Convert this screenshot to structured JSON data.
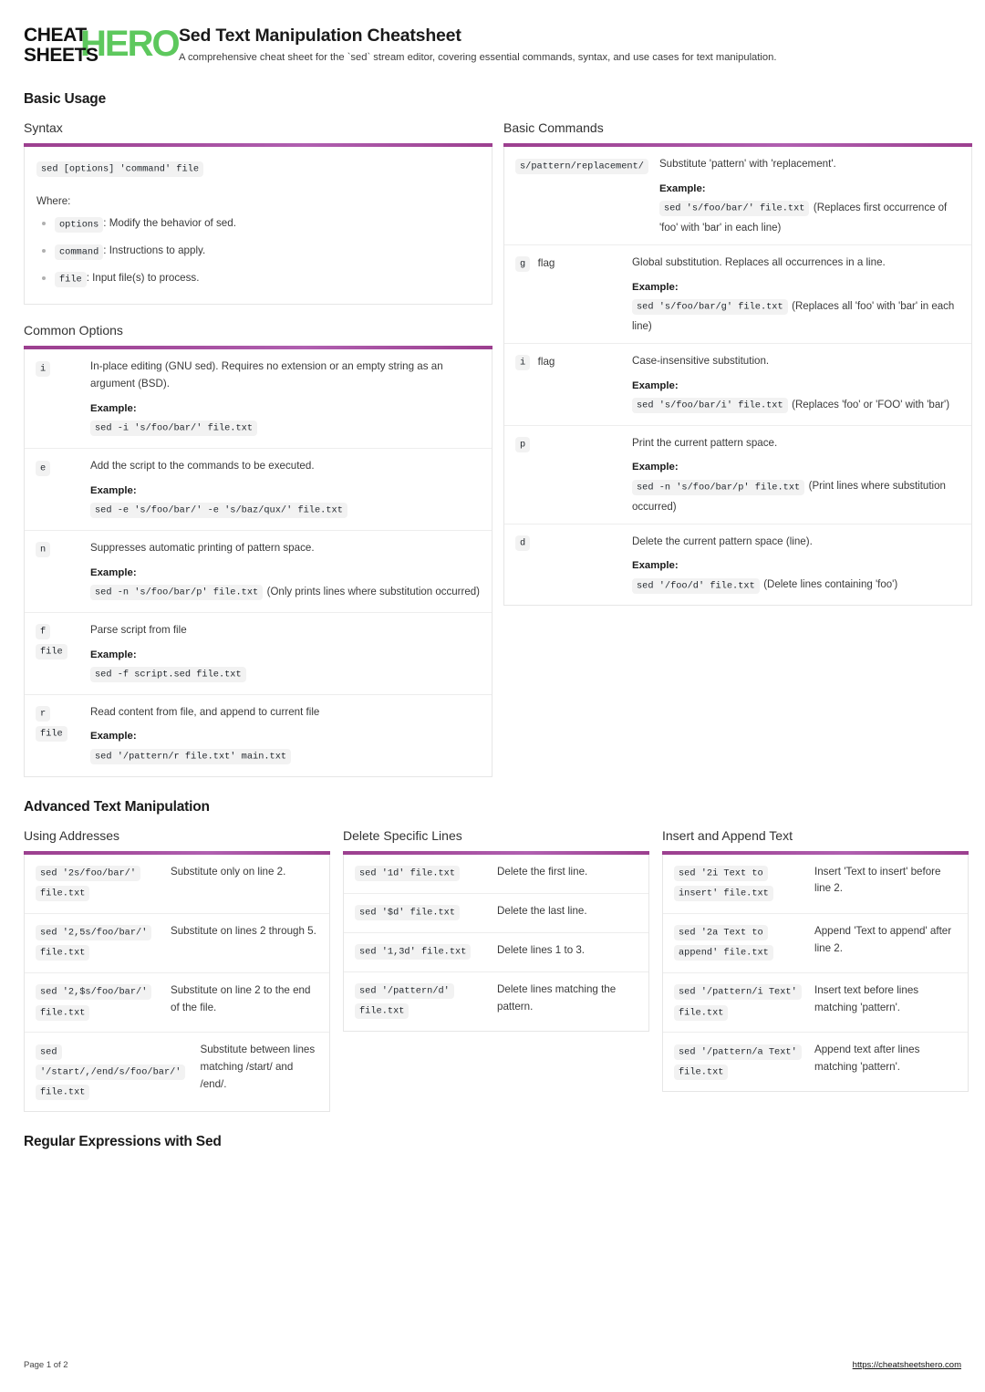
{
  "brand": {
    "line1": "CHEAT",
    "line2": "SHEETS",
    "hero": "HERO",
    "hero_color": "#5dc85d"
  },
  "header": {
    "title": "Sed Text Manipulation Cheatsheet",
    "subtitle": "A comprehensive cheat sheet for the `sed` stream editor, covering essential commands, syntax, and use cases for text manipulation."
  },
  "accent_color": "#9c3f8f",
  "sections": {
    "basic_usage": "Basic Usage",
    "advanced": "Advanced Text Manipulation",
    "regex": "Regular Expressions with Sed"
  },
  "syntax": {
    "heading": "Syntax",
    "code": "sed [options] 'command' file",
    "where": "Where:",
    "bullets": [
      {
        "code": "options",
        "text": ": Modify the behavior of sed."
      },
      {
        "code": "command",
        "text": ": Instructions to apply."
      },
      {
        "code": "file",
        "text": ": Input file(s) to process."
      }
    ]
  },
  "common_options": {
    "heading": "Common Options",
    "example_label": "Example:",
    "rows": [
      {
        "opt": "i",
        "opt2": "",
        "desc": "In-place editing (GNU sed). Requires no extension or an empty string as an argument (BSD).",
        "example": "sed -i 's/foo/bar/' file.txt",
        "note": ""
      },
      {
        "opt": "e",
        "opt2": "",
        "desc": "Add the script to the commands to be executed.",
        "example": "sed -e 's/foo/bar/' -e 's/baz/qux/' file.txt",
        "note": ""
      },
      {
        "opt": "n",
        "opt2": "",
        "desc": "Suppresses automatic printing of pattern space.",
        "example": "sed -n 's/foo/bar/p' file.txt",
        "note": "(Only prints lines where substitution occurred)"
      },
      {
        "opt": "f",
        "opt2": "file",
        "desc": "Parse script from file",
        "example": "sed -f script.sed file.txt",
        "note": ""
      },
      {
        "opt": "r",
        "opt2": "file",
        "desc": "Read content from file, and append to current file",
        "example": "sed '/pattern/r file.txt' main.txt",
        "note": ""
      }
    ]
  },
  "basic_commands": {
    "heading": "Basic Commands",
    "example_label": "Example:",
    "rows": [
      {
        "cmd": "s/pattern/replacement/",
        "flag": "",
        "desc": "Substitute 'pattern' with 'replacement'.",
        "example": "sed 's/foo/bar/' file.txt",
        "note": "(Replaces first occurrence of 'foo' with 'bar' in each line)"
      },
      {
        "cmd": "g",
        "flag": "flag",
        "desc": "Global substitution. Replaces all occurrences in a line.",
        "example": "sed 's/foo/bar/g' file.txt",
        "note": "(Replaces all 'foo' with 'bar' in each line)"
      },
      {
        "cmd": "i",
        "flag": "flag",
        "desc": "Case-insensitive substitution.",
        "example": "sed 's/foo/bar/i' file.txt",
        "note": "(Replaces 'foo' or 'FOO' with 'bar')"
      },
      {
        "cmd": "p",
        "flag": "",
        "desc": "Print the current pattern space.",
        "example": "sed -n 's/foo/bar/p' file.txt",
        "note": "(Print lines where substitution occurred)"
      },
      {
        "cmd": "d",
        "flag": "",
        "desc": "Delete the current pattern space (line).",
        "example": "sed '/foo/d' file.txt",
        "note": "(Delete lines containing 'foo')"
      }
    ]
  },
  "using_addresses": {
    "heading": "Using Addresses",
    "rows": [
      {
        "code": "sed '2s/foo/bar/' file.txt",
        "desc": "Substitute only on line 2."
      },
      {
        "code": "sed '2,5s/foo/bar/' file.txt",
        "desc": "Substitute on lines 2 through 5."
      },
      {
        "code": "sed '2,$s/foo/bar/' file.txt",
        "desc": "Substitute on line 2 to the end of the file."
      },
      {
        "code": "sed '/start/,/end/s/foo/bar/' file.txt",
        "desc": "Substitute between lines matching /start/ and /end/."
      }
    ]
  },
  "delete_lines": {
    "heading": "Delete Specific Lines",
    "rows": [
      {
        "code": "sed '1d' file.txt",
        "desc": "Delete the first line."
      },
      {
        "code": "sed '$d' file.txt",
        "desc": "Delete the last line."
      },
      {
        "code": "sed '1,3d' file.txt",
        "desc": "Delete lines 1 to 3."
      },
      {
        "code": "sed '/pattern/d' file.txt",
        "desc": "Delete lines matching the pattern."
      }
    ]
  },
  "insert_append": {
    "heading": "Insert and Append Text",
    "rows": [
      {
        "code": "sed '2i Text to insert' file.txt",
        "desc": "Insert 'Text to insert' before line 2."
      },
      {
        "code": "sed '2a Text to append' file.txt",
        "desc": "Append 'Text to append' after line 2."
      },
      {
        "code": "sed '/pattern/i Text' file.txt",
        "desc": "Insert text before lines matching 'pattern'."
      },
      {
        "code": "sed '/pattern/a Text' file.txt",
        "desc": "Append text after lines matching 'pattern'."
      }
    ]
  },
  "footer": {
    "page": "Page 1 of 2",
    "url": "https://cheatsheetshero.com"
  }
}
